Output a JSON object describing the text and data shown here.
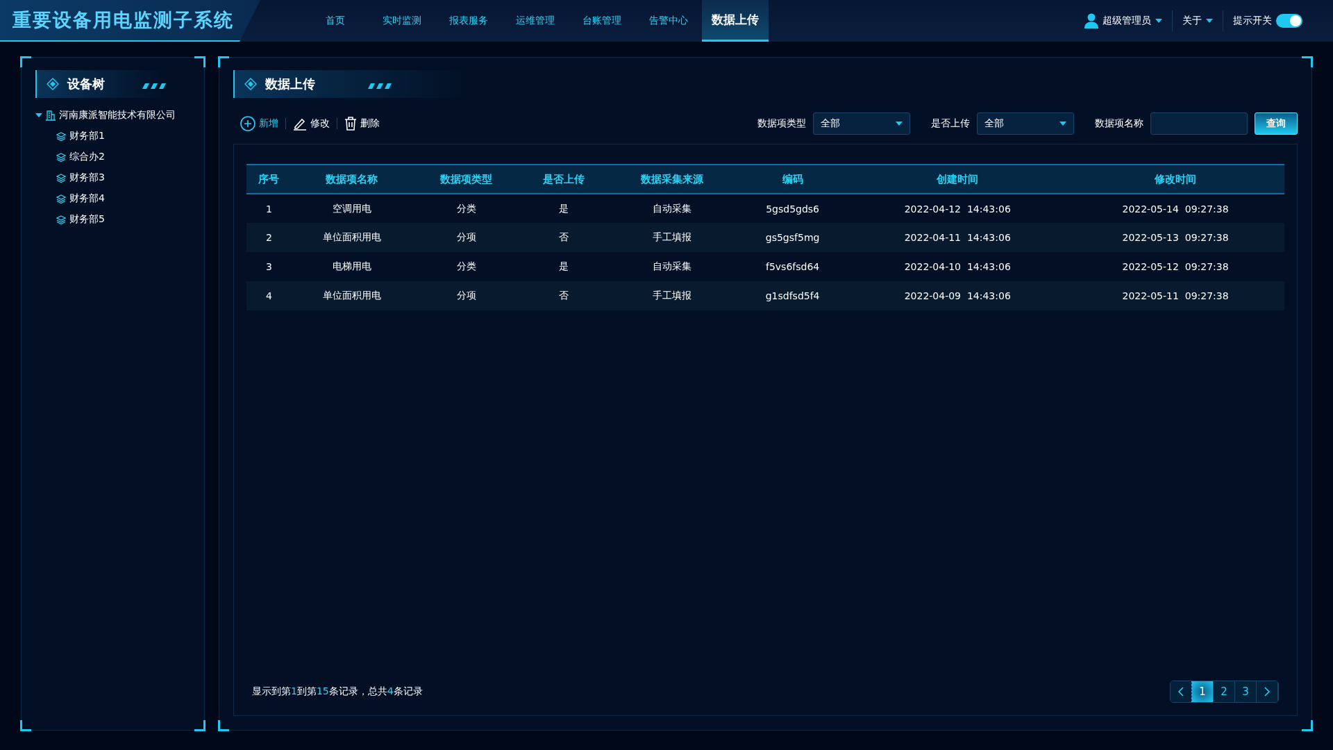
{
  "header": {
    "title": "重要设备用电监测子系统",
    "nav": [
      {
        "label": "首页",
        "selected": false
      },
      {
        "label": "实时监测",
        "selected": false
      },
      {
        "label": "报表服务",
        "selected": false
      },
      {
        "label": "运维管理",
        "selected": false
      },
      {
        "label": "台账管理",
        "selected": false
      },
      {
        "label": "告警中心",
        "selected": false
      },
      {
        "label": "数据上传",
        "selected": true
      }
    ],
    "user": "超级管理员",
    "about": "关于",
    "toggle": {
      "label": "提示开关",
      "on": true
    }
  },
  "sidebar": {
    "title": "设备树",
    "tree": [
      {
        "label": "河南康派智能技术有限公司",
        "expanded": true,
        "children": [
          {
            "label": "财务部1"
          },
          {
            "label": "综合办2"
          },
          {
            "label": "财务部3"
          },
          {
            "label": "财务部4"
          },
          {
            "label": "财务部5"
          }
        ]
      }
    ]
  },
  "main": {
    "title": "数据上传",
    "actions": [
      {
        "kind": "add",
        "label": "新增"
      },
      {
        "kind": "edit",
        "label": "修改"
      },
      {
        "kind": "delete",
        "label": "删除"
      }
    ],
    "filters": [
      {
        "kind": "select",
        "label": "数据项类型",
        "value": "全部"
      },
      {
        "kind": "select",
        "label": "是否上传",
        "value": "全部"
      },
      {
        "kind": "input",
        "label": "数据项名称"
      }
    ],
    "query": "查询",
    "table": {
      "columns": [
        "序号",
        "数据项名称",
        "数据项类型",
        "是否上传",
        "数据采集来源",
        "编码",
        "创建时间",
        "修改时间"
      ],
      "rows": [
        [
          "1",
          "空调用电",
          "分类",
          "是",
          "自动采集",
          "5gsd5gds6",
          "2022-04-12  14:43:06",
          "2022-05-14  09:27:38"
        ],
        [
          "2",
          "单位面积用电",
          "分项",
          "否",
          "手工填报",
          "gs5gsf5mg",
          "2022-04-11  14:43:06",
          "2022-05-13  09:27:38"
        ],
        [
          "3",
          "电梯用电",
          "分类",
          "是",
          "自动采集",
          "f5vs6fsd64",
          "2022-04-10  14:43:06",
          "2022-05-12  09:27:38"
        ],
        [
          "4",
          "单位面积用电",
          "分项",
          "否",
          "手工填报",
          "g1sdfsd5f4",
          "2022-04-09  14:43:06",
          "2022-05-11  09:27:38"
        ]
      ]
    },
    "summary": [
      {
        "text": "显示到第",
        "highlight": false
      },
      {
        "text": "1",
        "highlight": true
      },
      {
        "text": "到第",
        "highlight": false
      },
      {
        "text": "15",
        "highlight": true
      },
      {
        "text": "条记录，总共",
        "highlight": false
      },
      {
        "text": "4",
        "highlight": true
      },
      {
        "text": "条记录",
        "highlight": false
      }
    ],
    "pages": [
      {
        "label": "1",
        "selected": true
      },
      {
        "label": "2",
        "selected": false
      },
      {
        "label": "3",
        "selected": false
      }
    ]
  }
}
